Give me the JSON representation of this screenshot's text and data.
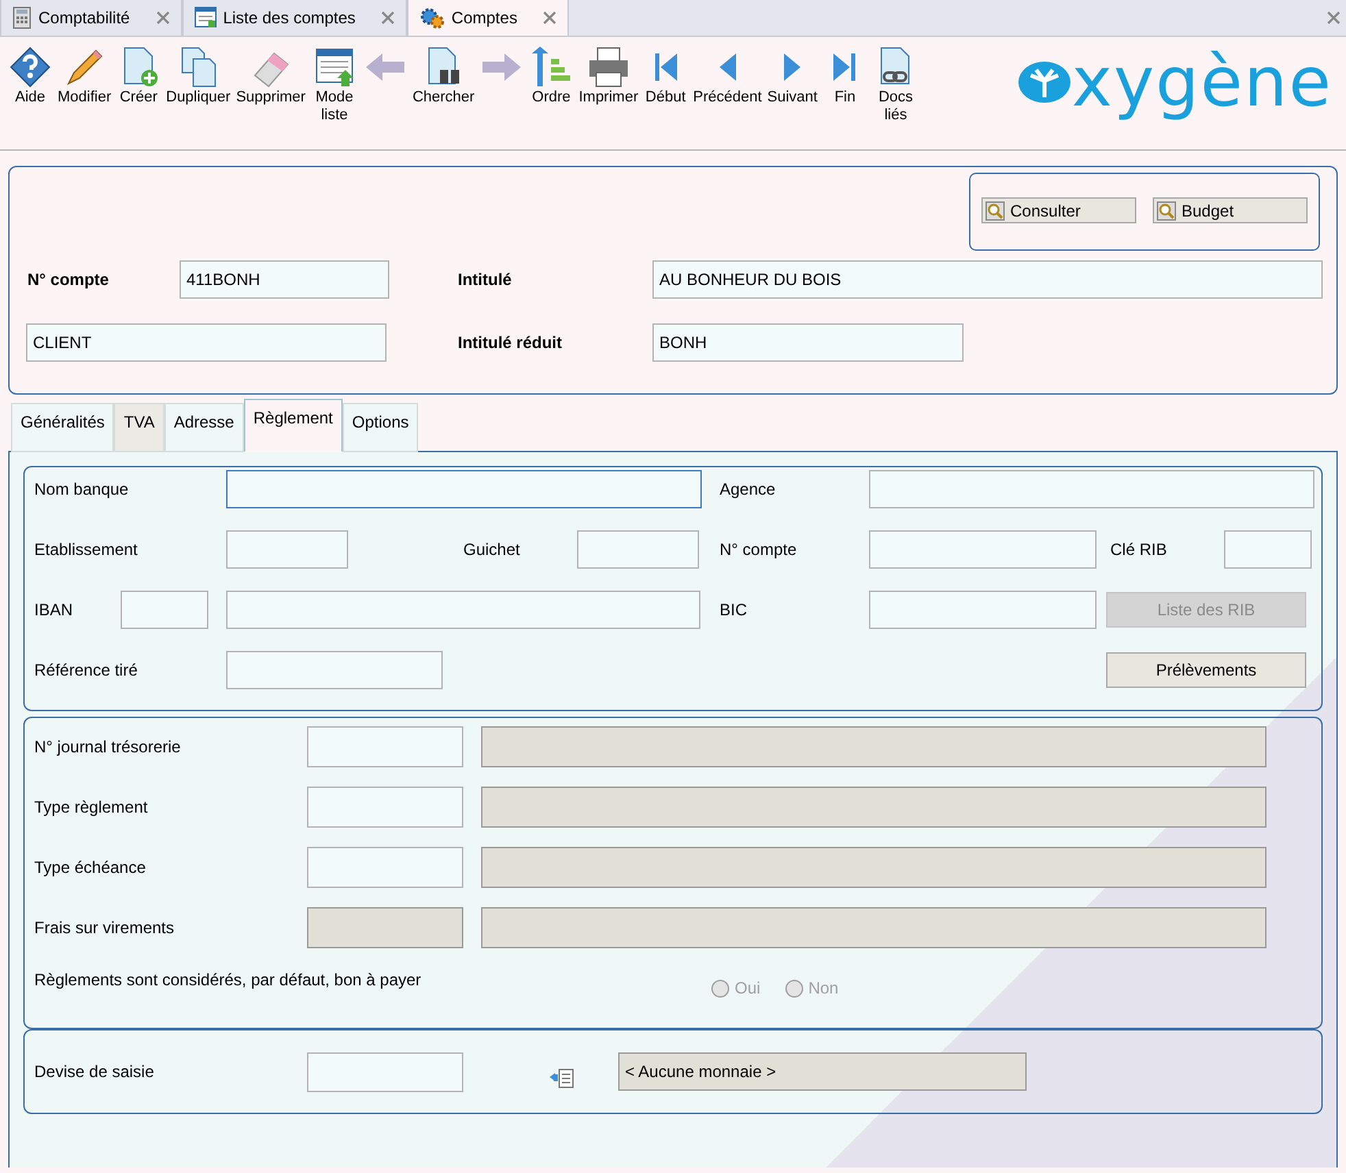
{
  "window_tabs": [
    {
      "label": "Comptabilité",
      "kind": "calculator",
      "selected": false
    },
    {
      "label": "Liste des comptes",
      "kind": "list",
      "selected": false
    },
    {
      "label": "Comptes",
      "kind": "gears",
      "selected": true
    }
  ],
  "toolbar": [
    {
      "label": "Aide",
      "kind": "help"
    },
    {
      "label": "Modifier",
      "kind": "edit"
    },
    {
      "label": "Créer",
      "kind": "create"
    },
    {
      "label": "Dupliquer",
      "kind": "duplicate"
    },
    {
      "label": "Supprimer",
      "kind": "delete"
    },
    {
      "label": "Mode liste",
      "kind": "listmode"
    },
    {
      "kind": "back"
    },
    {
      "label": "Chercher",
      "kind": "search"
    },
    {
      "kind": "forward"
    },
    {
      "label": "Ordre",
      "kind": "order"
    },
    {
      "label": "Imprimer",
      "kind": "print"
    },
    {
      "label": "Début",
      "kind": "first"
    },
    {
      "label": "Précédent",
      "kind": "prev"
    },
    {
      "label": "Suivant",
      "kind": "next"
    },
    {
      "label": "Fin",
      "kind": "last"
    },
    {
      "label": "Docs liés",
      "kind": "docs"
    }
  ],
  "logo": "xygène",
  "header": {
    "consult_button": "Consulter",
    "budget_button": "Budget",
    "account_label": "N° compte",
    "account_value": "411BONH",
    "title_label": "Intitulé",
    "title_value": "AU BONHEUR DU BOIS",
    "type_value": "CLIENT",
    "short_label": "Intitulé réduit",
    "short_value": "BONH"
  },
  "section_tabs": [
    {
      "label": "Généralités",
      "selected": false
    },
    {
      "label": "TVA",
      "selected": false
    },
    {
      "label": "Adresse",
      "selected": false
    },
    {
      "label": "Règlement",
      "selected": true
    },
    {
      "label": "Options",
      "selected": false
    }
  ],
  "bank_group": {
    "bank_name": {
      "label": "Nom banque",
      "focused": true
    },
    "agency": {
      "label": "Agence"
    },
    "establishment": {
      "label": "Etablissement"
    },
    "branch": {
      "label": "Guichet"
    },
    "account_number": {
      "label": "N° compte"
    },
    "rib_key": {
      "label": "Clé RIB"
    },
    "iban": {
      "label": "IBAN"
    },
    "bic": {
      "label": "BIC"
    },
    "rib_list_button": {
      "label": "Liste des RIB",
      "disabled": true
    },
    "drawer_ref": {
      "label": "Référence tiré"
    },
    "direct_debit_button": {
      "label": "Prélèvements",
      "disabled": false
    }
  },
  "payment_group": {
    "rows": [
      {
        "label": "N° journal trésorerie",
        "code_readonly": false
      },
      {
        "label": "Type règlement",
        "code_readonly": false
      },
      {
        "label": "Type échéance",
        "code_readonly": false
      },
      {
        "label": "Frais sur virements",
        "code_readonly": true
      }
    ],
    "default_question": "Règlements sont considérés, par défaut, bon à payer",
    "options": [
      {
        "label": "Oui",
        "selected": false,
        "disabled": true
      },
      {
        "label": "Non",
        "selected": false,
        "disabled": true
      }
    ]
  },
  "currency_group": {
    "label": "Devise de saisie",
    "currency_value": "< Aucune monnaie >"
  }
}
